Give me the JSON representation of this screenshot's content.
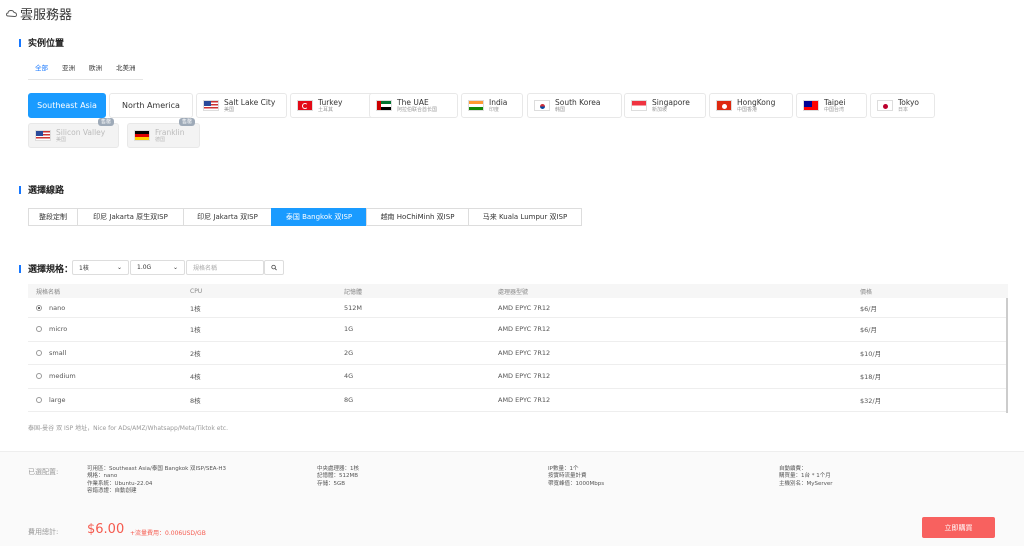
{
  "title": "雲服務器",
  "sections": {
    "location": "实例位置",
    "line": "選擇線路",
    "spec": "選擇規格："
  },
  "region_tabs": [
    "全部",
    "亚洲",
    "欧洲",
    "北美洲"
  ],
  "region_buttons": [
    "Southeast Asia",
    "North America"
  ],
  "locations": [
    {
      "name": "Salt Lake City",
      "sub": "美国",
      "flag": "us-flag-icon"
    },
    {
      "name": "Turkey",
      "sub": "土耳其",
      "flag": "turkey-flag-icon"
    },
    {
      "name": "The UAE",
      "sub": "阿拉伯联合酋长国",
      "flag": "uae-flag-icon"
    },
    {
      "name": "India",
      "sub": "印度",
      "flag": "india-flag-icon"
    },
    {
      "name": "South Korea",
      "sub": "韩国",
      "flag": "korea-flag-icon"
    },
    {
      "name": "Singapore",
      "sub": "新加坡",
      "flag": "singapore-flag-icon"
    },
    {
      "name": "HongKong",
      "sub": "中国香港",
      "flag": "hongkong-flag-icon"
    },
    {
      "name": "Taipei",
      "sub": "中国台湾",
      "flag": "taiwan-flag-icon"
    },
    {
      "name": "Tokyo",
      "sub": "日本",
      "flag": "japan-flag-icon"
    },
    {
      "name": "Silicon Valley",
      "sub": "美国",
      "flag": "us-flag-icon",
      "badge": "售罄"
    },
    {
      "name": "Franklin",
      "sub": "德国",
      "flag": "germany-flag-icon",
      "badge": "售罄"
    }
  ],
  "lines": [
    "整段定制",
    "印尼 Jakarta 原生双ISP",
    "印尼 Jakarta 双ISP",
    "泰国 Bangkok 双ISP",
    "越南 HoChiMinh 双ISP",
    "马来 Kuala Lumpur 双ISP"
  ],
  "filters": {
    "cpu": "1核",
    "mem": "1.0G",
    "placeholder": "規格名稱"
  },
  "table": {
    "headers": [
      "規格名稱",
      "CPU",
      "記憶體",
      "處理器型號",
      "價格"
    ],
    "rows": [
      [
        "nano",
        "1核",
        "512M",
        "AMD EPYC 7R12",
        "$6/月"
      ],
      [
        "micro",
        "1核",
        "1G",
        "AMD EPYC 7R12",
        "$6/月"
      ],
      [
        "small",
        "2核",
        "2G",
        "AMD EPYC 7R12",
        "$10/月"
      ],
      [
        "medium",
        "4核",
        "4G",
        "AMD EPYC 7R12",
        "$18/月"
      ],
      [
        "large",
        "8核",
        "8G",
        "AMD EPYC 7R12",
        "$32/月"
      ]
    ]
  },
  "note": "泰国-曼谷 双 ISP 地址，Nice for ADs/AMZ/Whatsapp/Meta/Tiktok etc.",
  "footer": {
    "configured_label": "已選配置:",
    "col1": [
      "可用區：Southeast Asia/泰国 Bangkok 双ISP/SEA-H3",
      "規格：nano",
      "作業系統：Ubuntu-22.04",
      "容錯憑證：自動創建"
    ],
    "col2": [
      "中央處理器：1核",
      "記憶體：512MB",
      "存儲：5GB"
    ],
    "col3": [
      "IP數量：1个",
      "按實時流量計費",
      "帶寬峰值：1000Mbps"
    ],
    "col4": [
      "自動續費：",
      "購買量：1台 * 1个月",
      "主機別名：MyServer"
    ],
    "total_label": "費用總計:",
    "price": "$6.00",
    "traffic": "+流量費用：0.006USD/GB",
    "buy": "立即購買"
  }
}
